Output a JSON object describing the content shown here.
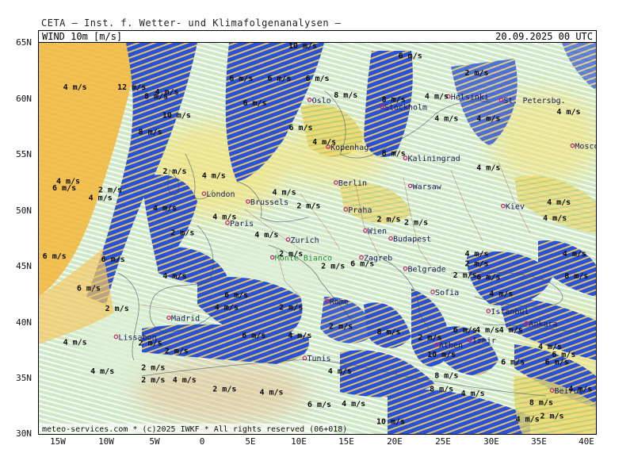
{
  "header": {
    "institute": "CETA — Inst. f. Wetter- und Klimafolgenanalysen —"
  },
  "title": {
    "field": "WIND 10m [m/s]",
    "datetime": "20.09.2025 00 UTC"
  },
  "footer": "meteo-services.com * (c)2025 IWKF * All rights reserved (06+018)",
  "axes": {
    "lat_labels": [
      "65N",
      "60N",
      "55N",
      "50N",
      "45N",
      "40N",
      "35N",
      "30N"
    ],
    "lon_labels": [
      "15W",
      "10W",
      "5W",
      "0",
      "5E",
      "10E",
      "15E",
      "20E",
      "25E",
      "30E",
      "35E",
      "40E"
    ]
  },
  "colors": {
    "calm": "#dcefd5",
    "light": "#a9d8a3",
    "moderate": "#f2e27c",
    "fresh": "#f3b63a",
    "strong": "#2850d8",
    "arrow_strong": "#f6d25a",
    "arrow_light": "#ffffff"
  },
  "cities": [
    {
      "name": "Oslo",
      "lat": 59.9,
      "lon": 10.7
    },
    {
      "name": "Stockholm",
      "lat": 59.3,
      "lon": 18.1
    },
    {
      "name": "Helsinki",
      "lat": 60.2,
      "lon": 24.9
    },
    {
      "name": "St. Petersbg.",
      "lat": 59.9,
      "lon": 30.3
    },
    {
      "name": "Moscow",
      "lat": 55.8,
      "lon": 37.6
    },
    {
      "name": "Kopenhag.",
      "lat": 55.7,
      "lon": 12.6
    },
    {
      "name": "Kaliningrad",
      "lat": 54.7,
      "lon": 20.5
    },
    {
      "name": "Berlin",
      "lat": 52.5,
      "lon": 13.4
    },
    {
      "name": "Warsaw",
      "lat": 52.2,
      "lon": 21.0
    },
    {
      "name": "London",
      "lat": 51.5,
      "lon": -0.1
    },
    {
      "name": "Brussels",
      "lat": 50.8,
      "lon": 4.4
    },
    {
      "name": "Paris",
      "lat": 48.9,
      "lon": 2.3
    },
    {
      "name": "Praha",
      "lat": 50.1,
      "lon": 14.4
    },
    {
      "name": "Kiev",
      "lat": 50.4,
      "lon": 30.5
    },
    {
      "name": "Wien",
      "lat": 48.2,
      "lon": 16.4
    },
    {
      "name": "Budapest",
      "lat": 47.5,
      "lon": 19.0
    },
    {
      "name": "Zurich",
      "lat": 47.4,
      "lon": 8.5
    },
    {
      "name": "Monte Bianco",
      "lat": 45.8,
      "lon": 6.9
    },
    {
      "name": "Zagreb",
      "lat": 45.8,
      "lon": 16.0
    },
    {
      "name": "Belgrade",
      "lat": 44.8,
      "lon": 20.5
    },
    {
      "name": "Sofia",
      "lat": 42.7,
      "lon": 23.3
    },
    {
      "name": "Istanbul",
      "lat": 41.0,
      "lon": 29.0
    },
    {
      "name": "Rome",
      "lat": 41.9,
      "lon": 12.5
    },
    {
      "name": "Madrid",
      "lat": 40.4,
      "lon": -3.7
    },
    {
      "name": "Ankara",
      "lat": 39.9,
      "lon": 32.9
    },
    {
      "name": "Lissabon",
      "lat": 38.7,
      "lon": -9.1
    },
    {
      "name": "Athen",
      "lat": 37.98,
      "lon": 23.7
    },
    {
      "name": "Izmir",
      "lat": 38.4,
      "lon": 27.1
    },
    {
      "name": "Tunis",
      "lat": 36.8,
      "lon": 10.2
    },
    {
      "name": "Beirut",
      "lat": 33.9,
      "lon": 35.5
    }
  ],
  "wind_labels": [
    {
      "text": "10 m/s",
      "lat": 64.5,
      "lon": 10.0
    },
    {
      "text": "6 m/s",
      "lat": 63.6,
      "lon": 21.0
    },
    {
      "text": "2 m/s",
      "lat": 62.1,
      "lon": 27.8
    },
    {
      "text": "4 m/s",
      "lat": 60.8,
      "lon": -13.3
    },
    {
      "text": "12 m/s",
      "lat": 60.8,
      "lon": -7.5
    },
    {
      "text": "4 m/s",
      "lat": 60.4,
      "lon": -3.9
    },
    {
      "text": "8 m/s",
      "lat": 60.0,
      "lon": -5.0
    },
    {
      "text": "6 m/s",
      "lat": 61.6,
      "lon": 3.7
    },
    {
      "text": "6 m/s",
      "lat": 61.6,
      "lon": 7.6
    },
    {
      "text": "6 m/s",
      "lat": 61.6,
      "lon": 11.5
    },
    {
      "text": "8 m/s",
      "lat": 60.1,
      "lon": 14.4
    },
    {
      "text": "8 m/s",
      "lat": 59.7,
      "lon": 19.3
    },
    {
      "text": "4 m/s",
      "lat": 60.0,
      "lon": 23.7
    },
    {
      "text": "6 m/s",
      "lat": 59.4,
      "lon": 5.1
    },
    {
      "text": "10 m/s",
      "lat": 58.3,
      "lon": -2.9
    },
    {
      "text": "4 m/s",
      "lat": 58.0,
      "lon": 24.7
    },
    {
      "text": "4 m/s",
      "lat": 58.0,
      "lon": 29.0
    },
    {
      "text": "4 m/s",
      "lat": 58.6,
      "lon": 37.2
    },
    {
      "text": "8 m/s",
      "lat": 56.8,
      "lon": -5.6
    },
    {
      "text": "6 m/s",
      "lat": 57.2,
      "lon": 9.8
    },
    {
      "text": "4 m/s",
      "lat": 55.9,
      "lon": 12.2
    },
    {
      "text": "8 m/s",
      "lat": 54.9,
      "lon": 19.3
    },
    {
      "text": "4 m/s",
      "lat": 53.6,
      "lon": 29.0
    },
    {
      "text": "2 m/s",
      "lat": 53.3,
      "lon": -3.1
    },
    {
      "text": "4 m/s",
      "lat": 52.9,
      "lon": 0.9
    },
    {
      "text": "4 m/s",
      "lat": 52.4,
      "lon": -14.0
    },
    {
      "text": "6 m/s",
      "lat": 51.8,
      "lon": -14.4
    },
    {
      "text": "2 m/s",
      "lat": 51.6,
      "lon": -9.7
    },
    {
      "text": "4 m/s",
      "lat": 50.9,
      "lon": -10.7
    },
    {
      "text": "4 m/s",
      "lat": 51.4,
      "lon": 8.1
    },
    {
      "text": "4 m/s",
      "lat": 50.0,
      "lon": -4.1
    },
    {
      "text": "2 m/s",
      "lat": 50.2,
      "lon": 10.6
    },
    {
      "text": "4 m/s",
      "lat": 49.2,
      "lon": 2.0
    },
    {
      "text": "2 m/s",
      "lat": 49.0,
      "lon": 18.8
    },
    {
      "text": "2 m/s",
      "lat": 48.7,
      "lon": 21.6
    },
    {
      "text": "4 m/s",
      "lat": 49.1,
      "lon": 35.8
    },
    {
      "text": "4 m/s",
      "lat": 50.5,
      "lon": 36.2
    },
    {
      "text": "2 m/s",
      "lat": 47.8,
      "lon": -2.3
    },
    {
      "text": "4 m/s",
      "lat": 47.6,
      "lon": 6.3
    },
    {
      "text": "6 m/s",
      "lat": 45.7,
      "lon": -15.4
    },
    {
      "text": "6 m/s",
      "lat": 45.4,
      "lon": -9.4
    },
    {
      "text": "2 m/s",
      "lat": 45.9,
      "lon": 8.8
    },
    {
      "text": "2 m/s",
      "lat": 44.8,
      "lon": 13.1
    },
    {
      "text": "6 m/s",
      "lat": 45.0,
      "lon": 16.1
    },
    {
      "text": "4 m/s",
      "lat": 45.9,
      "lon": 27.8
    },
    {
      "text": "4 m/s",
      "lat": 45.9,
      "lon": 37.8
    },
    {
      "text": "2 m/s",
      "lat": 45.0,
      "lon": 27.8
    },
    {
      "text": "2 m/s",
      "lat": 44.0,
      "lon": 26.6
    },
    {
      "text": "4 m/s",
      "lat": 43.9,
      "lon": -3.1
    },
    {
      "text": "6 m/s",
      "lat": 43.8,
      "lon": 29.0
    },
    {
      "text": "8 m/s",
      "lat": 43.9,
      "lon": 38.0
    },
    {
      "text": "6 m/s",
      "lat": 42.8,
      "lon": -11.9
    },
    {
      "text": "6 m/s",
      "lat": 42.2,
      "lon": 3.2
    },
    {
      "text": "4 m/s",
      "lat": 42.3,
      "lon": 30.3
    },
    {
      "text": "2 m/s",
      "lat": 41.0,
      "lon": -9.0
    },
    {
      "text": "4 m/s",
      "lat": 41.1,
      "lon": 2.2
    },
    {
      "text": "2 m/s",
      "lat": 41.1,
      "lon": 8.8
    },
    {
      "text": "2 m/s",
      "lat": 39.4,
      "lon": 13.9
    },
    {
      "text": "6 m/s",
      "lat": 38.6,
      "lon": 5.0
    },
    {
      "text": "4 m/s",
      "lat": 38.6,
      "lon": 9.7
    },
    {
      "text": "8 m/s",
      "lat": 38.9,
      "lon": 18.8
    },
    {
      "text": "2 m/s",
      "lat": 38.4,
      "lon": 23.0
    },
    {
      "text": "6 m/s",
      "lat": 39.1,
      "lon": 26.6
    },
    {
      "text": "4 m/s",
      "lat": 39.1,
      "lon": 28.9
    },
    {
      "text": "4 m/s",
      "lat": 39.1,
      "lon": 31.3
    },
    {
      "text": "4 m/s",
      "lat": 38.0,
      "lon": -13.3
    },
    {
      "text": "2 m/s",
      "lat": 37.9,
      "lon": -5.6
    },
    {
      "text": "2 m/s",
      "lat": 37.2,
      "lon": -2.9
    },
    {
      "text": "4 m/s",
      "lat": 37.6,
      "lon": 35.3
    },
    {
      "text": "6 m/s",
      "lat": 36.9,
      "lon": 36.7
    },
    {
      "text": "10 m/s",
      "lat": 36.9,
      "lon": 24.2
    },
    {
      "text": "6 m/s",
      "lat": 36.2,
      "lon": 31.5
    },
    {
      "text": "6 m/s",
      "lat": 36.2,
      "lon": 36.0
    },
    {
      "text": "2 m/s",
      "lat": 35.7,
      "lon": -5.3
    },
    {
      "text": "4 m/s",
      "lat": 35.4,
      "lon": -10.5
    },
    {
      "text": "4 m/s",
      "lat": 35.4,
      "lon": 13.8
    },
    {
      "text": "8 m/s",
      "lat": 35.0,
      "lon": 24.7
    },
    {
      "text": "2 m/s",
      "lat": 34.6,
      "lon": -5.3
    },
    {
      "text": "4 m/s",
      "lat": 34.6,
      "lon": -2.1
    },
    {
      "text": "2 m/s",
      "lat": 33.8,
      "lon": 2.0
    },
    {
      "text": "4 m/s",
      "lat": 33.5,
      "lon": 6.8
    },
    {
      "text": "8 m/s",
      "lat": 33.8,
      "lon": 24.2
    },
    {
      "text": "4 m/s",
      "lat": 33.4,
      "lon": 27.4
    },
    {
      "text": "4 m/s",
      "lat": 33.8,
      "lon": 38.4
    },
    {
      "text": "8 m/s",
      "lat": 32.6,
      "lon": 34.4
    },
    {
      "text": "6 m/s",
      "lat": 32.4,
      "lon": 11.7
    },
    {
      "text": "4 m/s",
      "lat": 32.5,
      "lon": 15.2
    },
    {
      "text": "2 m/s",
      "lat": 31.4,
      "lon": 35.5
    },
    {
      "text": "4 m/s",
      "lat": 31.1,
      "lon": 33.0
    },
    {
      "text": "10 m/s",
      "lat": 30.9,
      "lon": 19.0
    }
  ]
}
